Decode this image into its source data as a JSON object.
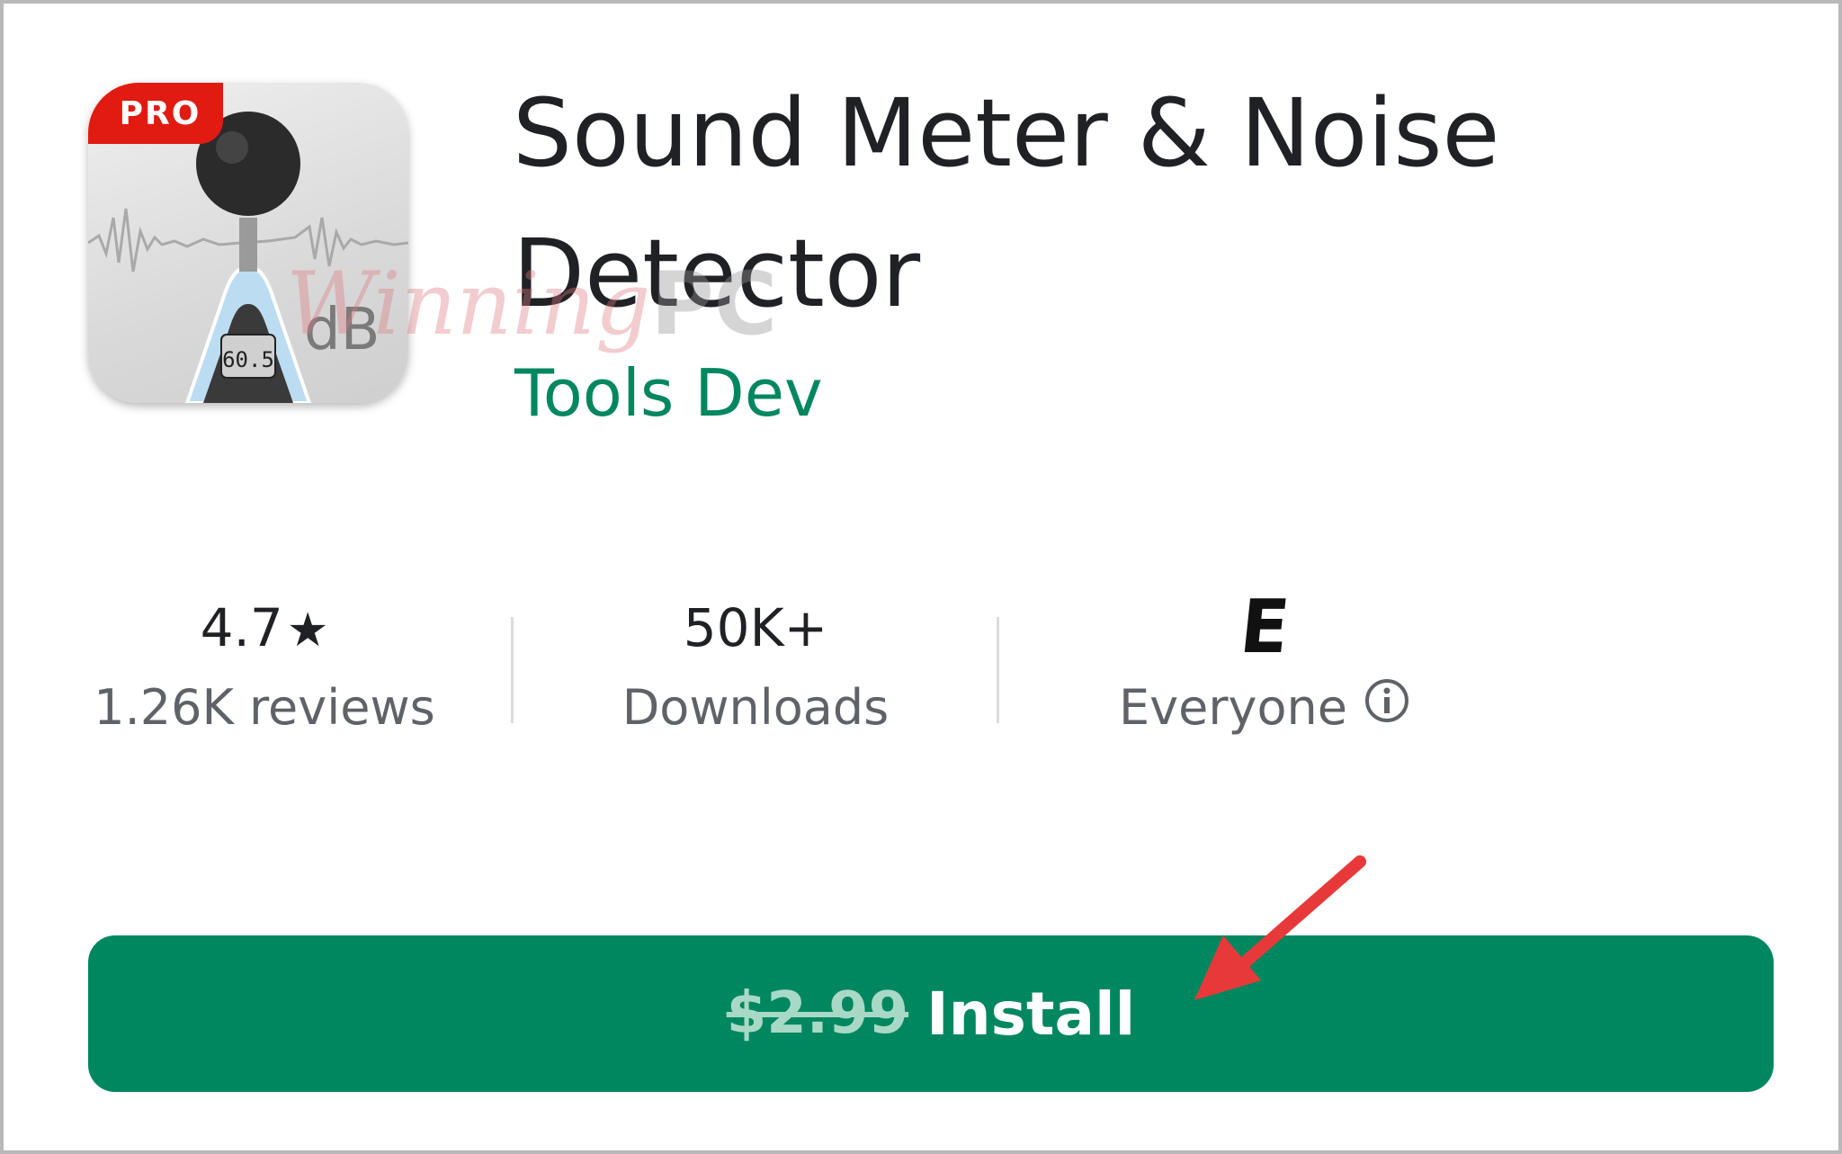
{
  "app": {
    "icon": {
      "badge": "PRO",
      "unit_label": "dB",
      "meter_reading": "60.5"
    },
    "title": "Sound Meter & Noise Detector",
    "developer": "Tools Dev"
  },
  "watermark": {
    "text_script": "Winning",
    "text_bold": "PC"
  },
  "stats": {
    "rating": {
      "value": "4.7",
      "star": "★",
      "label": "1.26K reviews"
    },
    "downloads": {
      "value": "50K+",
      "label": "Downloads"
    },
    "content_rating": {
      "badge": "E",
      "label": "Everyone",
      "icon": "info-icon"
    }
  },
  "install": {
    "old_price": "$2.99",
    "label": "Install"
  },
  "colors": {
    "accent_green": "#01875f",
    "badge_red": "#e11b12",
    "arrow_red": "#e8393a",
    "text_primary": "#202124",
    "text_secondary": "#5f6368"
  }
}
